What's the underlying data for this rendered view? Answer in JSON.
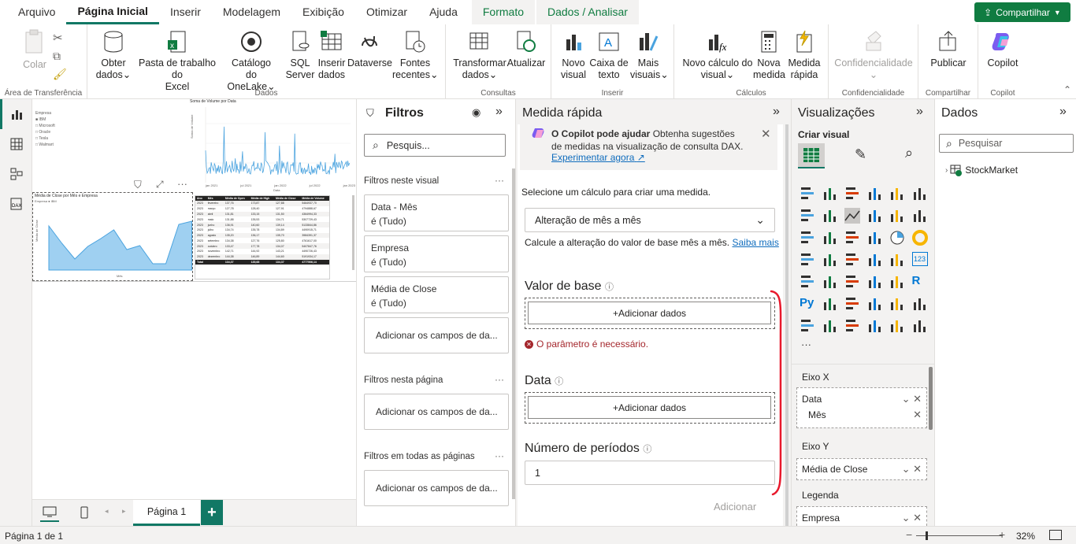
{
  "tabs": [
    "Arquivo",
    "Página Inicial",
    "Inserir",
    "Modelagem",
    "Exibição",
    "Otimizar",
    "Ajuda"
  ],
  "context_tabs": [
    "Formato",
    "Dados / Analisar"
  ],
  "share_label": "Compartilhar",
  "ribbon": {
    "clipboard": {
      "colar": "Colar",
      "label": "Área de Transferência"
    },
    "dados": {
      "label": "Dados",
      "obter": [
        "Obter",
        "dados"
      ],
      "pasta": [
        "Pasta de trabalho do",
        "Excel"
      ],
      "catalogo": [
        "Catálogo",
        "do OneLake"
      ],
      "sql": [
        "SQL",
        "Server"
      ],
      "inserir": [
        "Inserir",
        "dados"
      ],
      "dataverse": "Dataverse",
      "fontes": [
        "Fontes",
        "recentes"
      ]
    },
    "consultas": {
      "label": "Consultas",
      "transformar": [
        "Transformar",
        "dados"
      ],
      "atualizar": "Atualizar"
    },
    "inserir": {
      "label": "Inserir",
      "novo": [
        "Novo",
        "visual"
      ],
      "caixa": [
        "Caixa de",
        "texto"
      ],
      "mais": [
        "Mais",
        "visuais"
      ]
    },
    "calculos": {
      "label": "Cálculos",
      "novo_calc": [
        "Novo cálculo do",
        "visual"
      ],
      "nova_medida": [
        "Nova",
        "medida"
      ],
      "medida_rapida": [
        "Medida",
        "rápida"
      ]
    },
    "conf": {
      "label": "Confidencialidade",
      "btn": "Confidencialidade"
    },
    "compartilhar": {
      "label": "Compartilhar",
      "publicar": "Publicar"
    },
    "copilot": {
      "label": "Copilot",
      "btn": "Copilot"
    }
  },
  "canvas": {
    "legend_title": "Empresa",
    "legend_items": [
      "IBM",
      "Microsoft",
      "Oracle",
      "Tesla",
      "Walmart"
    ],
    "chart1_title": "Soma de Volume por Data",
    "chart1_xlabel": "Data",
    "chart1_ylabel": "Soma de Volume",
    "chart1_ticks": [
      "jan 2021",
      "jul 2021",
      "jan 2022",
      "jul 2022",
      "jan 2023"
    ],
    "chart2_title": "Média de Close por Mês e Empresa",
    "chart2_legend": "Empresa ● IBM",
    "chart2_ylabel": "Média de Close",
    "chart2_xlabel": "Mês",
    "table_headers": [
      "Ano",
      "Mês",
      "Média de Open",
      "Média de High",
      "Média de Close",
      "Média de Volume"
    ],
    "table_rows": [
      [
        "2023",
        "fevereiro",
        "137,76",
        "173,87",
        "127,88",
        "5464937,70"
      ],
      [
        "2023",
        "março",
        "127,78",
        "128,40",
        "127,91",
        "4794888,67"
      ],
      [
        "2023",
        "abril",
        "131,81",
        "133,15",
        "131,50",
        "4364994,33"
      ],
      [
        "2023",
        "maio",
        "131,88",
        "135,53",
        "134,71",
        "5307729,43"
      ],
      [
        "2023",
        "junho",
        "136,91",
        "140,60",
        "139,14",
        "5133844,86"
      ],
      [
        "2023",
        "julho",
        "134,74",
        "135,78",
        "134,89",
        "4490915,71"
      ],
      [
        "2023",
        "agosto",
        "135,20",
        "136,17",
        "135,70",
        "3984391,37"
      ],
      [
        "2023",
        "setembro",
        "134,38",
        "127,76",
        "125,80",
        "4761617,00"
      ],
      [
        "2023",
        "outubro",
        "133,47",
        "177,78",
        "134,07",
        "5407847,76"
      ],
      [
        "2023",
        "novembro",
        "142,71",
        "144,92",
        "143,21",
        "4490726,43"
      ],
      [
        "2023",
        "dezembro",
        "144,38",
        "146,89",
        "144,60",
        "5191934,17"
      ]
    ],
    "table_total": [
      "Total",
      "",
      "134,37",
      "135,68",
      "134,37",
      "4777506,14"
    ]
  },
  "page_tabs": {
    "page1": "Página 1",
    "add": "+"
  },
  "status": {
    "page": "Página 1 de 1",
    "zoom": "32%"
  },
  "filters": {
    "title": "Filtros",
    "search_placeholder": "Pesquis...",
    "visual_section": "Filtros neste visual",
    "cards": [
      {
        "name": "Data - Mês",
        "value": "é (Tudo)"
      },
      {
        "name": "Empresa",
        "value": "é (Tudo)"
      },
      {
        "name": "Média de Close",
        "value": "é (Tudo)"
      }
    ],
    "add_fields": "Adicionar os campos de da...",
    "page_section": "Filtros nesta página",
    "all_section": "Filtros em todas as páginas",
    "more": "···"
  },
  "quick_measure": {
    "title": "Medida rápida",
    "copilot_bold": "O Copilot pode ajudar",
    "copilot_text1": "Obtenha sugestões",
    "copilot_text2": "de medidas na visualização de consulta DAX.",
    "copilot_link": "Experimentar agora",
    "select_label": "Selecione um cálculo para criar uma medida.",
    "calc_value": "Alteração de mês a mês",
    "calc_desc": "Calcule a alteração do valor de base mês a mês.",
    "learn_more": "Saiba mais",
    "base_label": "Valor de base",
    "add_data": "+Adicionar dados",
    "error": "O parâmetro é necessário.",
    "date_label": "Data",
    "periods_label": "Número de períodos",
    "periods_value": "1",
    "submit": "Adicionar"
  },
  "viz": {
    "title": "Visualizações",
    "create": "Criar visual",
    "more": "···",
    "axis_x": "Eixo X",
    "axis_x_fields": [
      "Data",
      "Mês"
    ],
    "axis_y": "Eixo Y",
    "axis_y_field": "Média de Close",
    "legend": "Legenda",
    "legend_field": "Empresa"
  },
  "dados": {
    "title": "Dados",
    "search_placeholder": "Pesquisar",
    "table": "StockMarket"
  },
  "colors": {
    "accent": "#117865",
    "green": "#107c41",
    "line": "#4aa3df",
    "error": "#a4262c",
    "annotation": "#e8192c"
  }
}
